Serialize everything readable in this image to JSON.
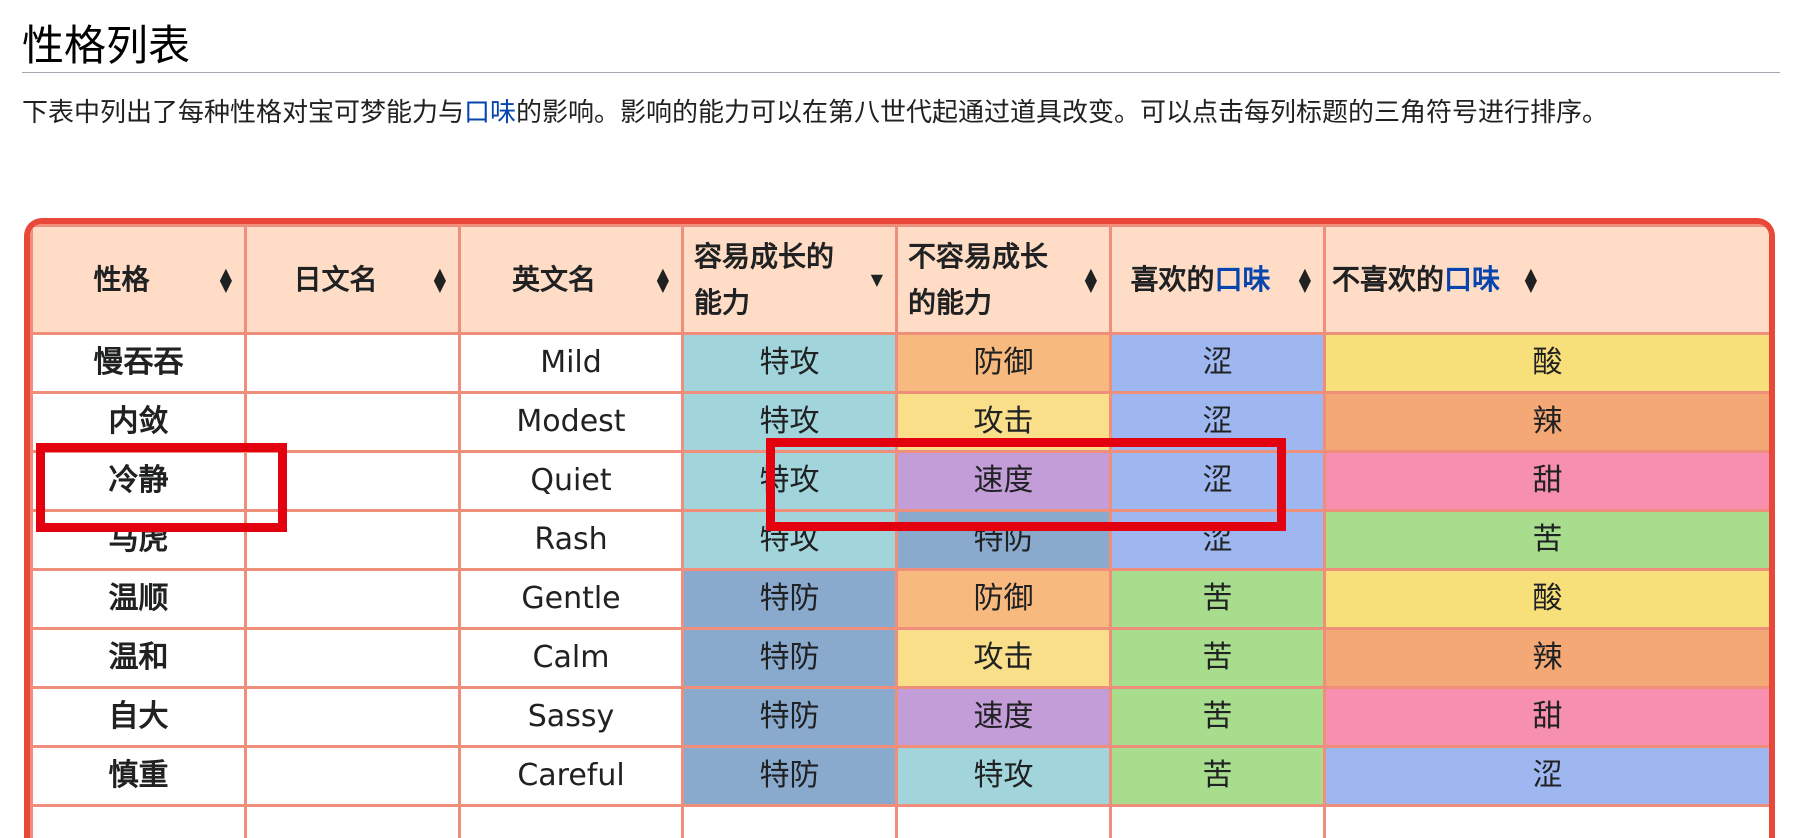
{
  "heading": "性格列表",
  "intro": {
    "before_link": "下表中列出了每种性格对宝可梦能力与",
    "link": "口味",
    "after_link": "的影响。影响的能力可以在第八世代起通过道具改变。可以点击每列标题的三角符号进行排序。"
  },
  "table": {
    "headers": {
      "nature": "性格",
      "japanese": "日文名",
      "english": "英文名",
      "increased": "容易成长的能力",
      "decreased": "不容易成长的能力",
      "liked_prefix": "喜欢的",
      "liked_link": "口味",
      "disliked_prefix": "不喜欢的",
      "disliked_link": "口味"
    },
    "rows": [
      {
        "nature": "慢吞吞",
        "japanese": "",
        "english": "Mild",
        "increased": "特攻",
        "decreased": "防御",
        "liked": "涩",
        "disliked": "酸"
      },
      {
        "nature": "内敛",
        "japanese": "",
        "english": "Modest",
        "increased": "特攻",
        "decreased": "攻击",
        "liked": "涩",
        "disliked": "辣"
      },
      {
        "nature": "冷静",
        "japanese": "",
        "english": "Quiet",
        "increased": "特攻",
        "decreased": "速度",
        "liked": "涩",
        "disliked": "甜"
      },
      {
        "nature": "马虎",
        "japanese": "",
        "english": "Rash",
        "increased": "特攻",
        "decreased": "特防",
        "liked": "涩",
        "disliked": "苦"
      },
      {
        "nature": "温顺",
        "japanese": "",
        "english": "Gentle",
        "increased": "特防",
        "decreased": "防御",
        "liked": "苦",
        "disliked": "酸"
      },
      {
        "nature": "温和",
        "japanese": "",
        "english": "Calm",
        "increased": "特防",
        "decreased": "攻击",
        "liked": "苦",
        "disliked": "辣"
      },
      {
        "nature": "自大",
        "japanese": "",
        "english": "Sassy",
        "increased": "特防",
        "decreased": "速度",
        "liked": "苦",
        "disliked": "甜"
      },
      {
        "nature": "慎重",
        "japanese": "",
        "english": "Careful",
        "increased": "特防",
        "decreased": "特攻",
        "liked": "苦",
        "disliked": "涩"
      },
      {
        "nature": "",
        "japanese": "",
        "english": "",
        "increased": "",
        "decreased": "",
        "liked": "",
        "disliked": ""
      }
    ]
  },
  "colors": {
    "frame_border": "#e8473a",
    "header_bg": "#ffdcc6",
    "cell_border": "#ef8f7b",
    "highlight": "#e3000f",
    "特攻": "#a1d5db",
    "特防": "#89a9cd",
    "防御": "#f8b97f",
    "攻击": "#f9df8a",
    "速度": "#c39dd7",
    "涩": "#9fb7f1",
    "苦": "#a7dd8c",
    "酸": "#f7df79",
    "辣": "#f3a875",
    "甜": "#f78faf"
  }
}
